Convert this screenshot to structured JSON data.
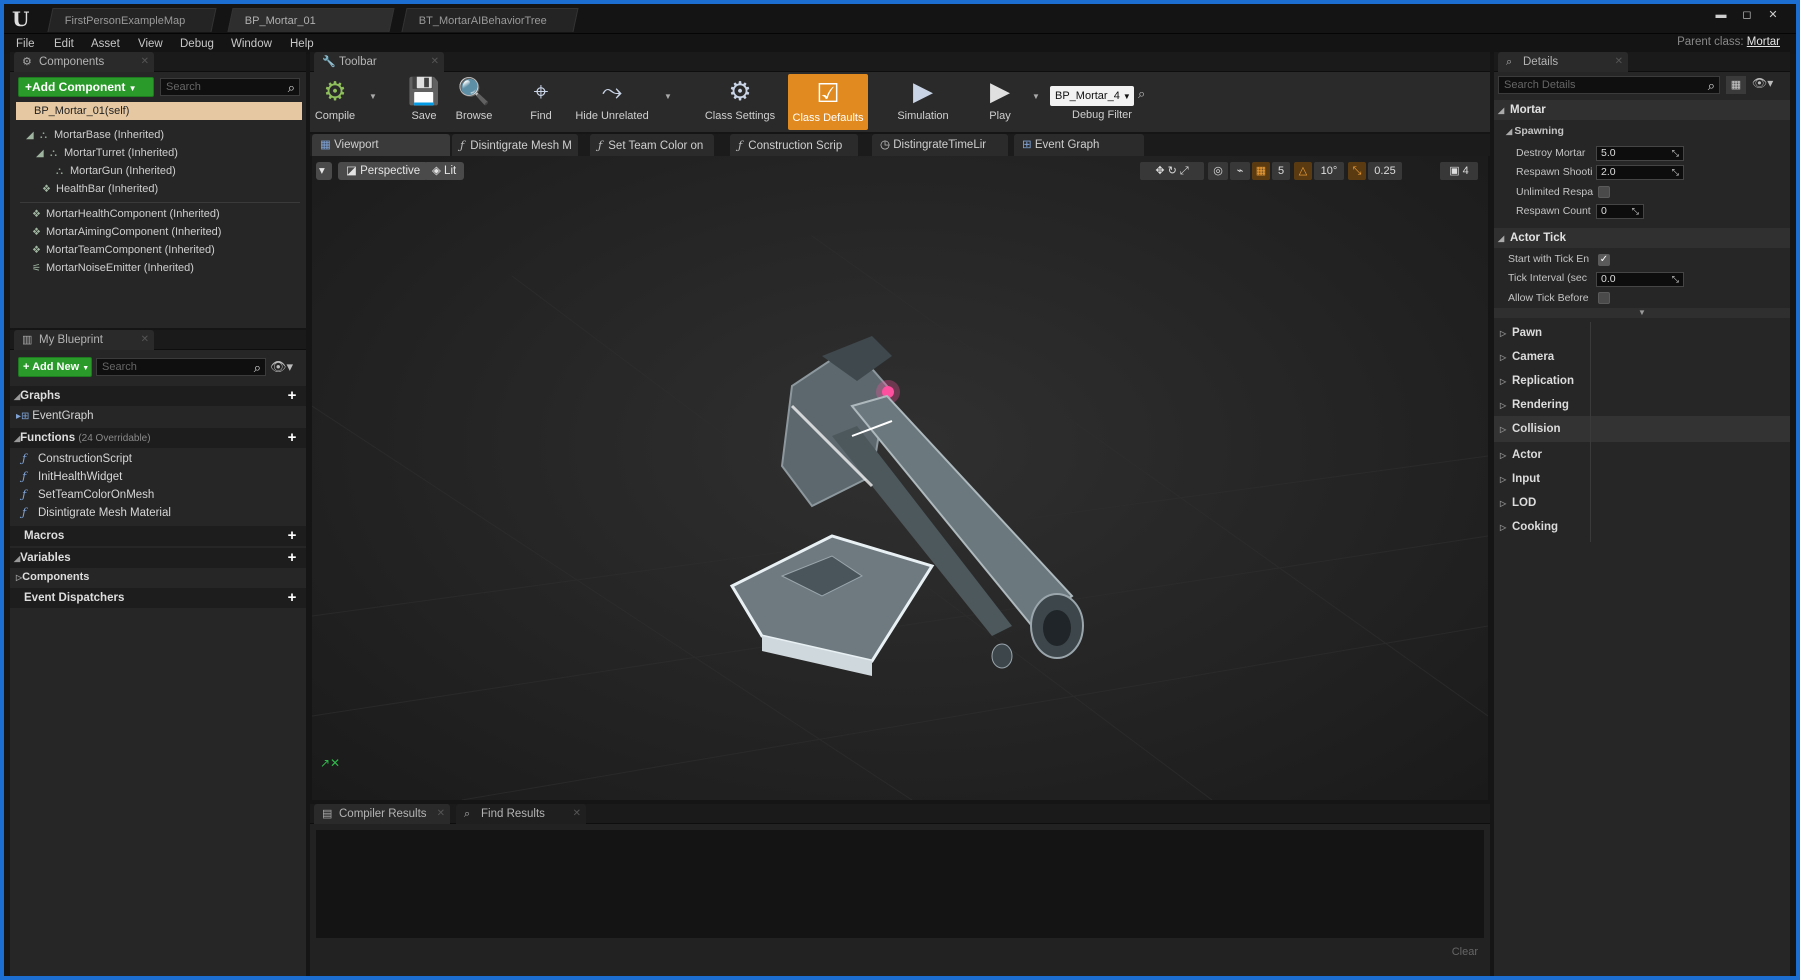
{
  "titlebar": {
    "tabs": [
      "FirstPersonExampleMap",
      "BP_Mortar_01",
      "BT_MortarAIBehaviorTree"
    ],
    "min": "▬",
    "max": "◻",
    "close": "✕"
  },
  "menu": [
    "File",
    "Edit",
    "Asset",
    "View",
    "Debug",
    "Window",
    "Help"
  ],
  "parent_class": {
    "label": "Parent class:",
    "value": "Mortar"
  },
  "components": {
    "tab": "Components",
    "add_button": "+Add Component",
    "search_placeholder": "Search",
    "self": "BP_Mortar_01(self)",
    "tree": [
      "MortarBase (Inherited)",
      "MortarTurret (Inherited)",
      "MortarGun (Inherited)",
      "HealthBar (Inherited)",
      "MortarHealthComponent (Inherited)",
      "MortarAimingComponent (Inherited)",
      "MortarTeamComponent (Inherited)",
      "MortarNoiseEmitter (Inherited)"
    ]
  },
  "my_blueprint": {
    "tab": "My Blueprint",
    "add_new": "+ Add New",
    "search_placeholder": "Search",
    "graphs": "Graphs",
    "event_graph": "EventGraph",
    "functions": "Functions",
    "functions_count": "(24 Overridable)",
    "function_list": [
      "ConstructionScript",
      "InitHealthWidget",
      "SetTeamColorOnMesh",
      "Disintigrate Mesh Material"
    ],
    "macros": "Macros",
    "variables": "Variables",
    "components": "Components",
    "event_dispatchers": "Event Dispatchers"
  },
  "toolbar": {
    "tab": "Toolbar",
    "buttons": [
      "Compile",
      "Save",
      "Browse",
      "Find",
      "Hide Unrelated",
      "Class Settings",
      "Class Defaults",
      "Simulation",
      "Play"
    ],
    "debug_object": "BP_Mortar_4",
    "debug_filter": "Debug Filter"
  },
  "editor_tabs": [
    "Viewport",
    "Disintigrate Mesh M",
    "Set Team Color on",
    "Construction Scrip",
    "DistingrateTimeLir",
    "Event Graph"
  ],
  "viewport": {
    "perspective": "Perspective",
    "lit": "Lit",
    "grid_snap": "5",
    "rot_snap": "10°",
    "scale_snap": "0.25",
    "cam_speed": "4"
  },
  "bottom": {
    "tabs": [
      "Compiler Results",
      "Find Results"
    ],
    "clear": "Clear"
  },
  "details": {
    "tab": "Details",
    "search_placeholder": "Search Details",
    "mortar": "Mortar",
    "spawning": "Spawning",
    "props": [
      {
        "label": "Destroy Mortar",
        "value": "5.0"
      },
      {
        "label": "Respawn Shooti",
        "value": "2.0"
      },
      {
        "label": "Unlimited Respa",
        "value": ""
      },
      {
        "label": "Respawn Count",
        "value": "0"
      }
    ],
    "actor_tick": "Actor Tick",
    "tick_props": [
      {
        "label": "Start with Tick En",
        "value": "✓"
      },
      {
        "label": "Tick Interval (sec",
        "value": "0.0"
      },
      {
        "label": "Allow Tick Before",
        "value": ""
      }
    ],
    "categories": [
      "Pawn",
      "Camera",
      "Replication",
      "Rendering",
      "Collision",
      "Actor",
      "Input",
      "LOD",
      "Cooking"
    ]
  }
}
